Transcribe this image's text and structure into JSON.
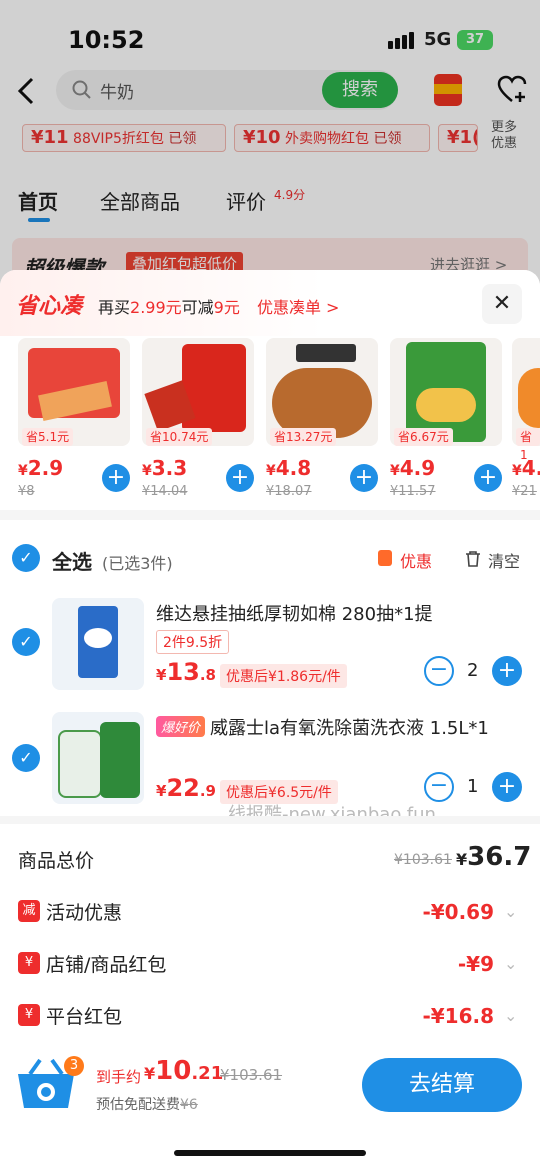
{
  "status": {
    "time": "10:52",
    "network": "5G",
    "battery": "37"
  },
  "header": {
    "search_text": "牛奶",
    "search_button": "搜索",
    "coupons": [
      {
        "amount": "¥11",
        "label": "88VIP5折红包",
        "state": "已领"
      },
      {
        "amount": "¥10",
        "label": "外卖购物红包",
        "state": "已领"
      },
      {
        "amount": "¥1("
      }
    ],
    "more": "更多优惠",
    "tabs": [
      "首页",
      "全部商品",
      "评价"
    ],
    "rating": "4.9分",
    "hot_title": "超级爆款",
    "hot_tag": "叠加红包超低价",
    "hot_link": "进去逛逛 >"
  },
  "sheet": {
    "logo": "省心凑",
    "promo_prefix": "再买",
    "promo_amount": "2.99元",
    "promo_mid": "可减",
    "promo_discount": "9元",
    "promo_link": "优惠凑单 >",
    "cards": [
      {
        "save": "省5.1元",
        "price": "2.9",
        "orig": "¥8"
      },
      {
        "save": "省10.74元",
        "price": "3.3",
        "orig": "¥14.04"
      },
      {
        "save": "省13.27元",
        "price": "4.8",
        "orig": "¥18.07"
      },
      {
        "save": "省6.67元",
        "price": "4.9",
        "orig": "¥11.57"
      },
      {
        "save": "省1",
        "price": "4.",
        "orig": "¥21"
      }
    ],
    "select_all": "全选",
    "selected_count": "(已选3件)",
    "youhui": "优惠",
    "clear": "清空",
    "items": [
      {
        "title": "维达悬挂抽纸厚韧如棉 280抽*1提",
        "tag": "2件9.5折",
        "price_int": "13",
        "price_dec": ".8",
        "after": "优惠后¥1.86元/件",
        "qty": "2"
      },
      {
        "badge": "爆好价",
        "title": "威露士la有氧洗除菌洗衣液 1.5L*1",
        "price_int": "22",
        "price_dec": ".9",
        "after": "优惠后¥6.5元/件",
        "qty": "1"
      }
    ],
    "watermark": "线报酷-new.xianbao.fun",
    "summary": {
      "label": "商品总价",
      "orig": "¥103.61",
      "total_int": "36",
      "total_dec": ".7",
      "rows": [
        {
          "icon": "减",
          "label": "活动优惠",
          "value": "-¥0.69"
        },
        {
          "icon": "¥",
          "label": "店铺/商品红包",
          "value": "-¥9"
        },
        {
          "icon": "¥",
          "label": "平台红包",
          "value": "-¥16.8"
        }
      ]
    },
    "bottom": {
      "cart_count": "3",
      "est_label": "到手约",
      "est_int": "10",
      "est_dec": ".21",
      "est_orig": "¥103.61",
      "ship_label": "预估免配送费",
      "ship_orig": "¥6",
      "checkout": "去结算"
    }
  }
}
